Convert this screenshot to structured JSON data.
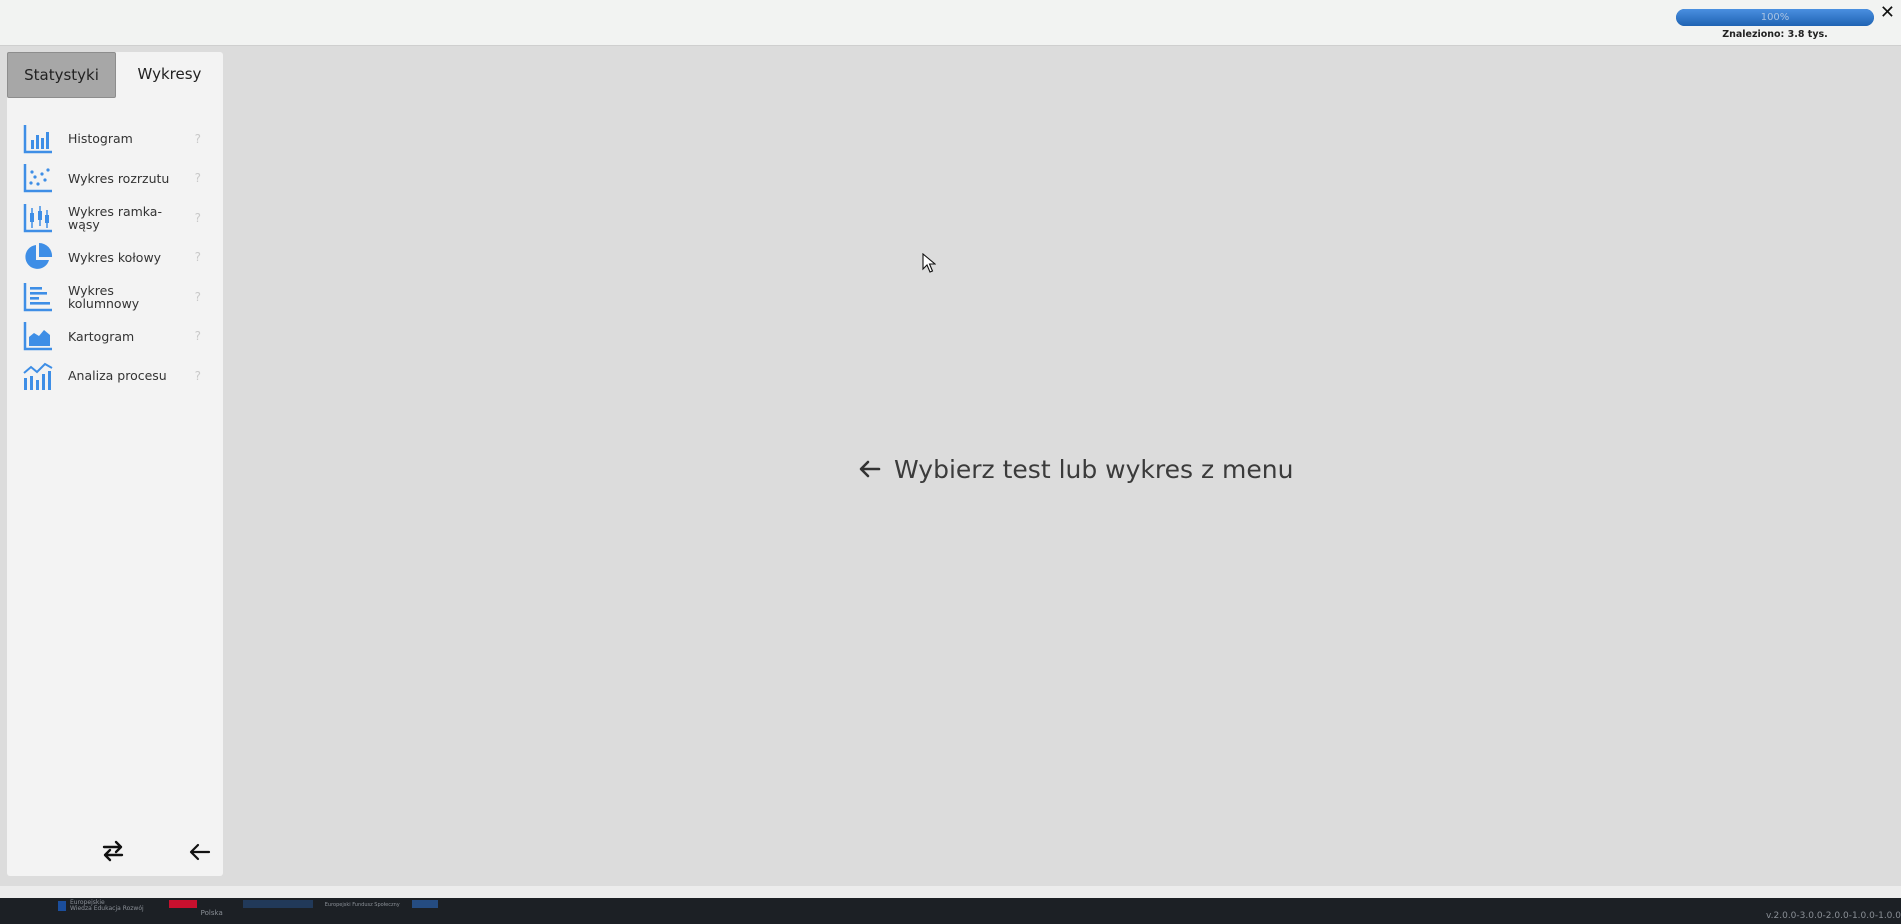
{
  "header": {
    "progress_label": "100%",
    "progress_fraction": 1.0,
    "found_text": "Znaleziono: 3.8 tys.",
    "close_label": "✕"
  },
  "sidebar": {
    "tabs": [
      {
        "label": "Statystyki",
        "active": true
      },
      {
        "label": "Wykresy",
        "active": false
      }
    ],
    "items": [
      {
        "label": "Histogram",
        "icon": "histogram-icon",
        "help": "?"
      },
      {
        "label": "Wykres rozrzutu",
        "icon": "scatter-icon",
        "help": "?"
      },
      {
        "label": "Wykres ramka-wąsy",
        "icon": "boxplot-icon",
        "help": "?"
      },
      {
        "label": "Wykres kołowy",
        "icon": "pie-chart-icon",
        "help": "?"
      },
      {
        "label": "Wykres kolumnowy",
        "icon": "column-chart-icon",
        "help": "?"
      },
      {
        "label": "Kartogram",
        "icon": "area-chart-icon",
        "help": "?"
      },
      {
        "label": "Analiza procesu",
        "icon": "process-chart-icon",
        "help": "?"
      }
    ]
  },
  "main": {
    "placeholder": "Wybierz test lub wykres z menu"
  },
  "footer": {
    "eu_line1": "Europejskie",
    "eu_line2": "Wiedza Edukacja Rozwój",
    "pl_label": "Polska",
    "partner_text": "Europejski Fundusz Społeczny",
    "version": "v.2.0.0-3.0.0-2.0.0-1.0.0-1.0.0"
  },
  "colors": {
    "accent": "#3e8ee6",
    "progress": "#1f63b3"
  }
}
